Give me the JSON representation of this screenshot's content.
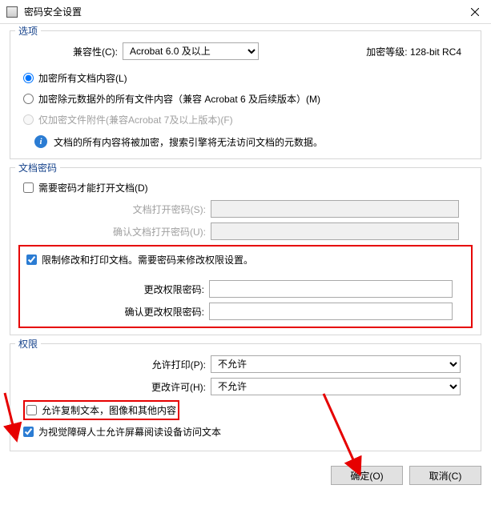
{
  "title": "密码安全设置",
  "options": {
    "group_title": "选项",
    "compat_label": "兼容性(C):",
    "compat_value": "Acrobat 6.0 及以上",
    "encrypt_level_label": "加密等级:",
    "encrypt_level_value": "128-bit RC4",
    "radio_all": "加密所有文档内容(L)",
    "radio_except": "加密除元数据外的所有文件内容（兼容 Acrobat 6 及后续版本）(M)",
    "radio_attach": "仅加密文件附件(兼容Acrobat 7及以上版本)(F)",
    "info": "文档的所有内容将被加密，搜索引擎将无法访问文档的元数据。"
  },
  "docpw": {
    "group_title": "文档密码",
    "check_require": "需要密码才能打开文档(D)",
    "open_label": "文档打开密码(S):",
    "open_confirm_label": "确认文档打开密码(U):",
    "restrict_check": "限制修改和打印文档。需要密码来修改权限设置。",
    "perm_pw_label": "更改权限密码:",
    "perm_pw_confirm_label": "确认更改权限密码:"
  },
  "perm": {
    "group_title": "权限",
    "print_label": "允许打印(P):",
    "print_value": "不允许",
    "change_label": "更改许可(H):",
    "change_value": "不允许",
    "copy_check": "允许复制文本，图像和其他内容",
    "screenreader_check": "为视觉障碍人士允许屏幕阅读设备访问文本"
  },
  "buttons": {
    "ok": "确定(O)",
    "cancel": "取消(C)"
  }
}
